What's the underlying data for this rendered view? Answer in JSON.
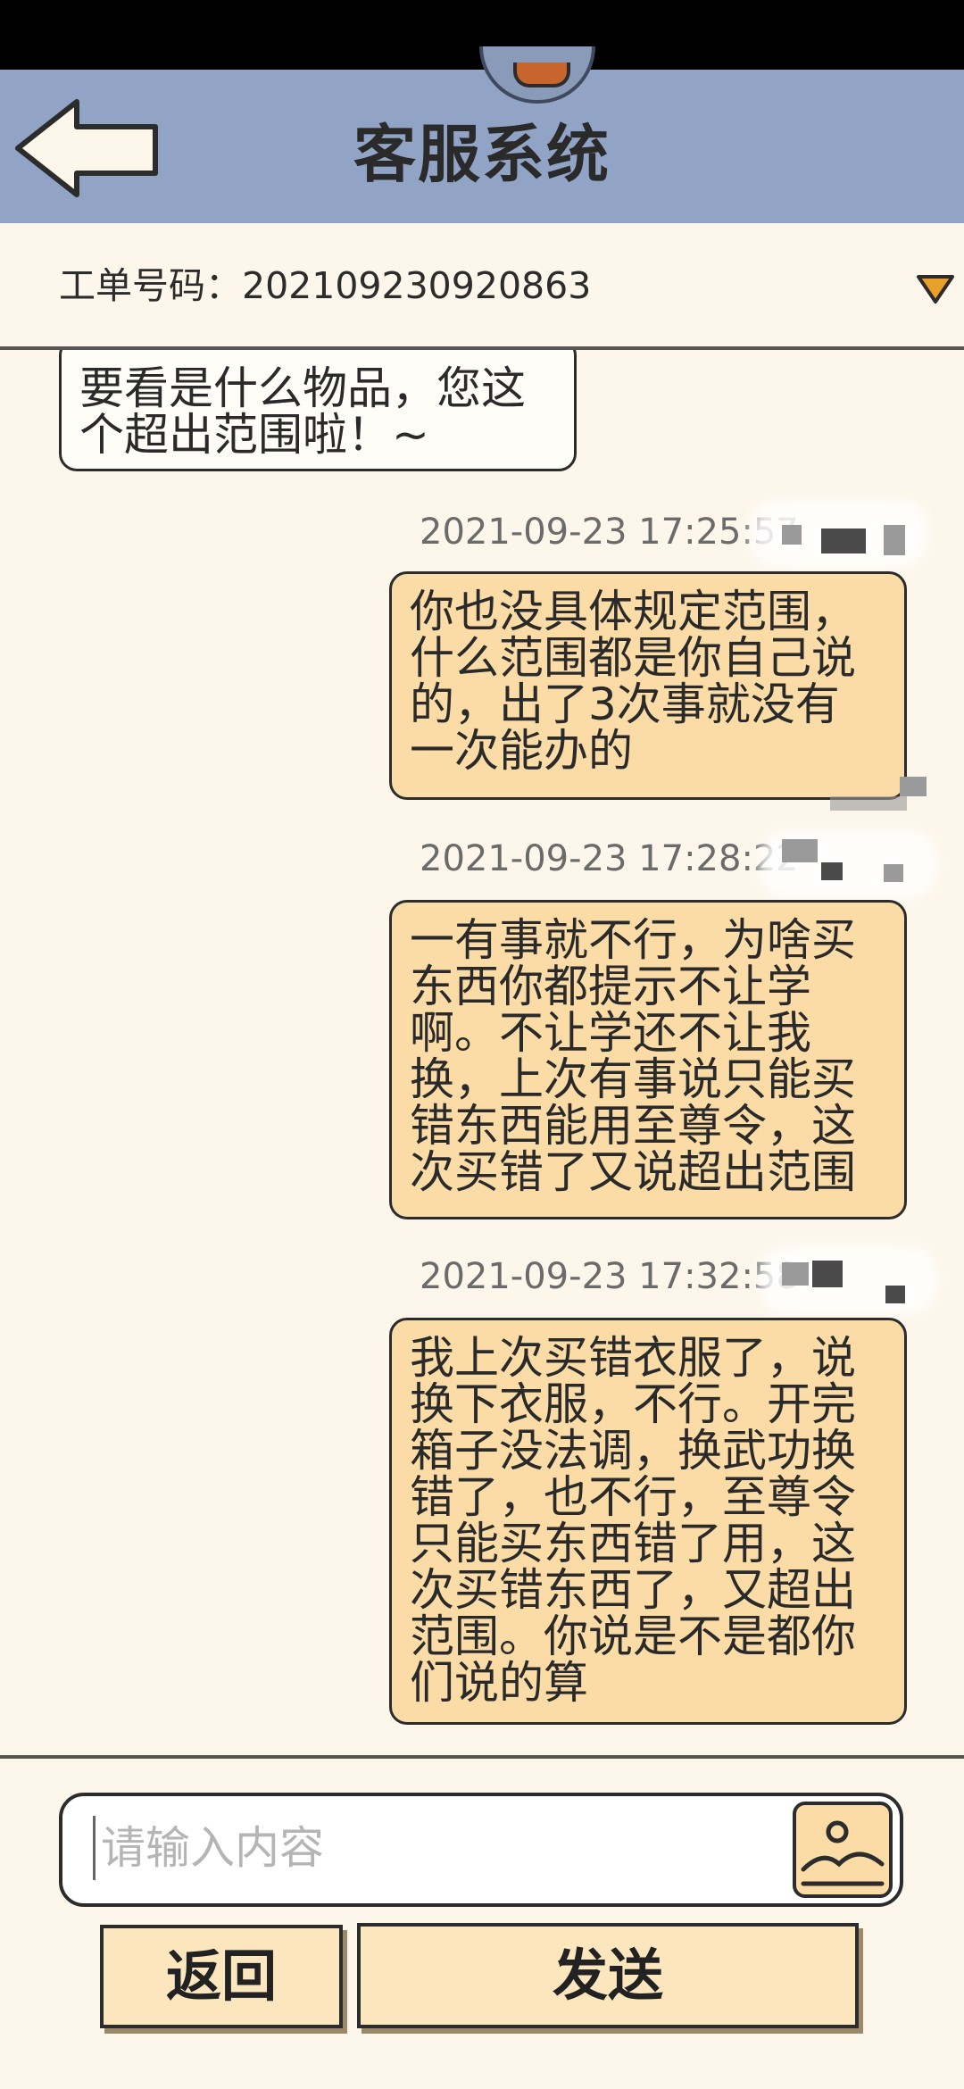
{
  "header": {
    "title": "客服系统"
  },
  "ticket": {
    "label": "工单号码：202109230920863"
  },
  "messages": [
    {
      "side": "left",
      "text_lines": [
        "要看是什么物品，您这",
        "个超出范围啦！~"
      ]
    },
    {
      "side": "right",
      "timestamp": "2021-09-23 17:25:57",
      "text_lines": [
        "你也没具体规定范围，",
        "什么范围都是你自己说",
        "的，出了3次事就没有",
        "一次能办的"
      ]
    },
    {
      "side": "right",
      "timestamp": "2021-09-23 17:28:22",
      "text_lines": [
        "一有事就不行，为啥买",
        "东西你都提示不让学",
        "啊。不让学还不让我",
        "换，上次有事说只能买",
        "错东西能用至尊令，这",
        "次买错了又说超出范围"
      ]
    },
    {
      "side": "right",
      "timestamp": "2021-09-23 17:32:58",
      "text_lines": [
        "我上次买错衣服了，说",
        "换下衣服，不行。开完",
        "箱子没法调，换武功换",
        "错了，也不行，至尊令",
        "只能买东西错了用，这",
        "次买错东西了，又超出",
        "范围。你说是不是都你",
        "们说的算"
      ]
    }
  ],
  "input": {
    "placeholder": "请输入内容",
    "value": ""
  },
  "buttons": {
    "back_label": "返回",
    "send_label": "发送"
  },
  "icons": {
    "back": "back-arrow-icon",
    "dropdown": "triangle-down-icon",
    "image": "image-icon"
  },
  "colors": {
    "header_bg": "#91a4c5",
    "bubble_right": "#fbdca6",
    "bubble_left": "#fffdf8",
    "page_bg": "#fdf6ea",
    "dropdown": "#e9a02b"
  }
}
